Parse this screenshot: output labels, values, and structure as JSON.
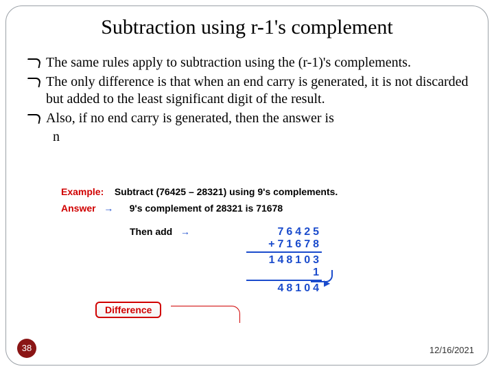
{
  "title": "Subtraction using r-1's complement",
  "bullets": {
    "b1": "The same rules apply to subtraction using the (r-1)'s complements.",
    "b2": "The only difference is that when an end carry is generated, it is not discarded but added to the least significant digit of the result.",
    "b3": "Also, if no end carry is generated, then the answer is",
    "b3_leftover": "n"
  },
  "example": {
    "example_label": "Example:",
    "example_text": "Subtract (76425 – 28321) using 9's complements.",
    "answer_label": "Answer",
    "arrow": "→",
    "comp_text": "9's complement of 28321 is 71678",
    "then_add": "Then add",
    "n1": "76425",
    "n2": "+71678",
    "sum": "148103",
    "carry": "1",
    "result": "48104",
    "difference_label": "Difference"
  },
  "page": "38",
  "date": "12/16/2021"
}
